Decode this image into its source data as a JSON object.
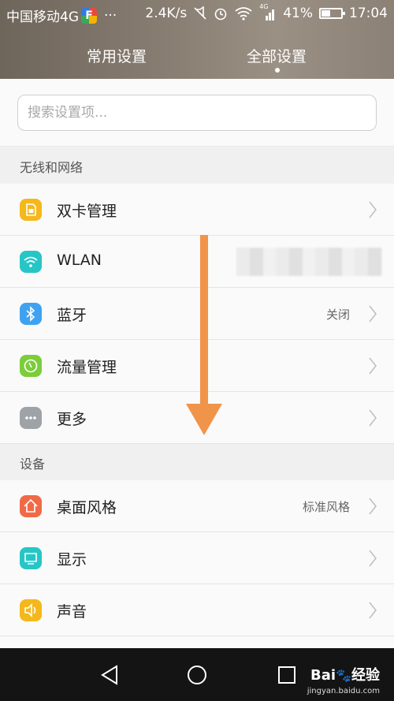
{
  "status_bar": {
    "carrier": "中国移动4G",
    "dots": "···",
    "net_speed": "2.4K/s",
    "signal_tag": "4G",
    "battery": "41%",
    "time": "17:04"
  },
  "tabs": [
    {
      "label": "常用设置",
      "active": false
    },
    {
      "label": "全部设置",
      "active": true
    }
  ],
  "search": {
    "placeholder": "搜索设置项...",
    "value": ""
  },
  "sections": [
    {
      "title": "无线和网络",
      "items": [
        {
          "label": "双卡管理",
          "value": "",
          "icon": "sim-card-icon",
          "color": "#f5b81c"
        },
        {
          "label": "WLAN",
          "value": "",
          "icon": "wifi-icon",
          "color": "#26c6c6"
        },
        {
          "label": "蓝牙",
          "value": "关闭",
          "icon": "bluetooth-icon",
          "color": "#3fa2f0"
        },
        {
          "label": "流量管理",
          "value": "",
          "icon": "data-usage-icon",
          "color": "#7ccc3c"
        },
        {
          "label": "更多",
          "value": "",
          "icon": "more-icon",
          "color": "#9ea3a8"
        }
      ]
    },
    {
      "title": "设备",
      "items": [
        {
          "label": "桌面风格",
          "value": "标准风格",
          "icon": "home-icon",
          "color": "#f06a47"
        },
        {
          "label": "显示",
          "value": "",
          "icon": "display-icon",
          "color": "#26c6c6"
        },
        {
          "label": "声音",
          "value": "",
          "icon": "sound-icon",
          "color": "#f5b81c"
        }
      ]
    }
  ],
  "annotation_arrow_color": "#f0944a",
  "watermark": {
    "brand": "Bai",
    "suffix": "经验",
    "url": "jingyan.baidu.com"
  }
}
